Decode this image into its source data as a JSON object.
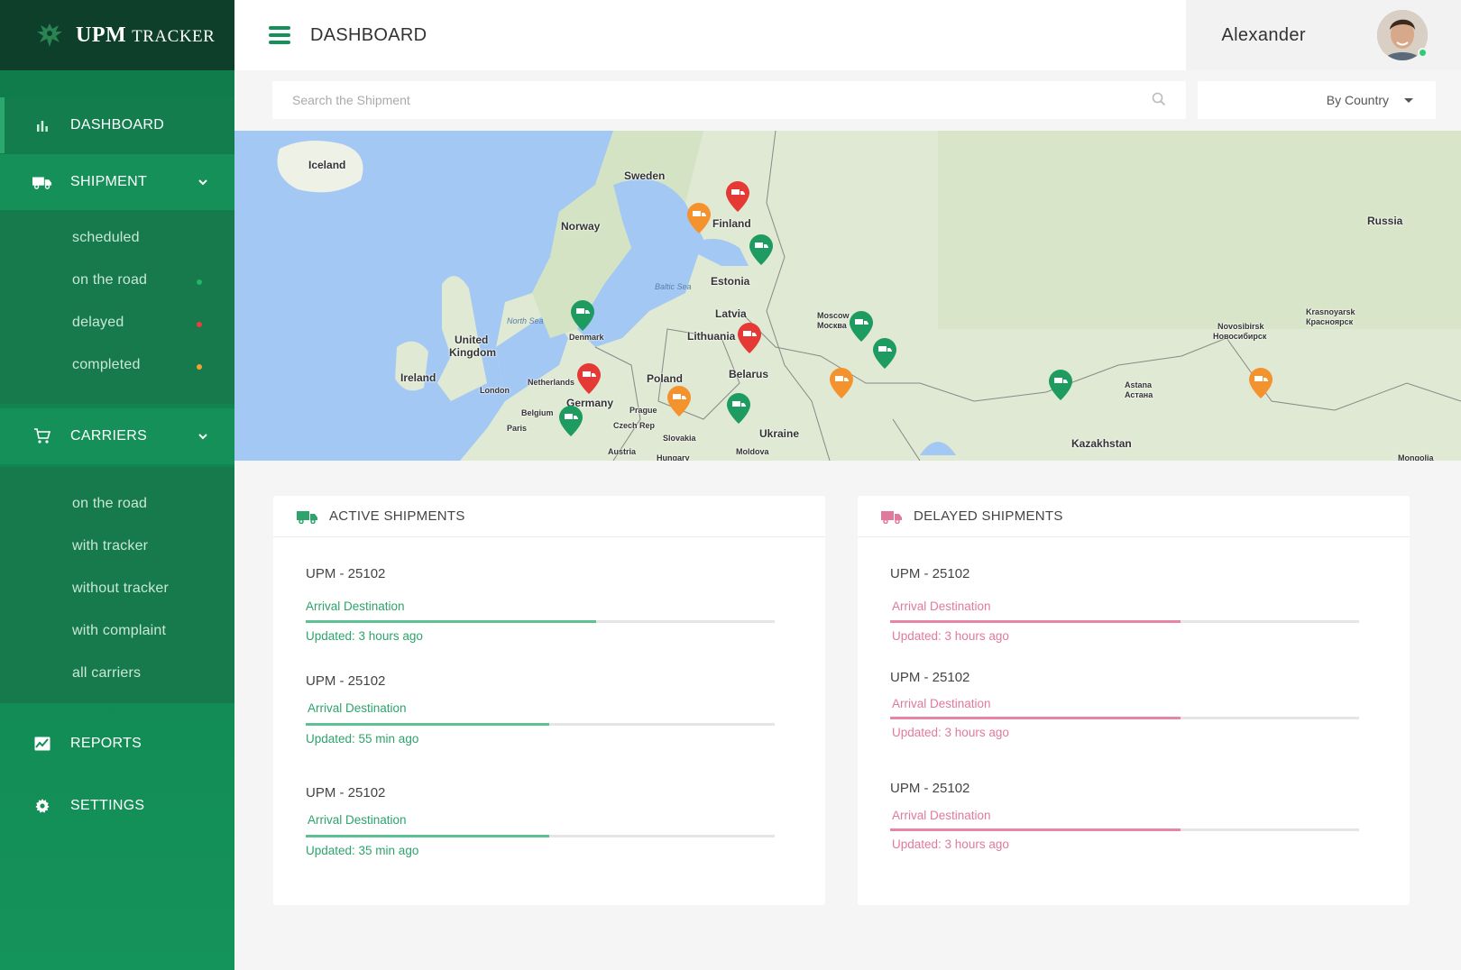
{
  "brand": {
    "strong": "UPM",
    "rest": "TRACKER"
  },
  "sidebar": {
    "dashboard": "DASHBOARD",
    "shipment": "SHIPMENT",
    "shipment_items": [
      {
        "label": "scheduled",
        "dot": ""
      },
      {
        "label": "on the road",
        "dot": "#1fb56a"
      },
      {
        "label": "delayed",
        "dot": "#ef3b3b"
      },
      {
        "label": "completed",
        "dot": "#f6a033"
      }
    ],
    "carriers": "CARRIERS",
    "carrier_items": [
      "on the road",
      "with tracker",
      "without tracker",
      "with complaint",
      "all carriers"
    ],
    "reports": "REPORTS",
    "settings": "SETTINGS"
  },
  "header": {
    "title": "DASHBOARD",
    "user": "Alexander"
  },
  "search": {
    "placeholder": "Search the Shipment",
    "value": ""
  },
  "filter": {
    "selected": "By Country"
  },
  "map": {
    "labels": {
      "iceland": "Iceland",
      "sweden": "Sweden",
      "finland": "Finland",
      "norway": "Norway",
      "estonia": "Estonia",
      "latvia": "Latvia",
      "lithuania": "Lithuania",
      "denmark": "Denmark",
      "united_kingdom_1": "United",
      "united_kingdom_2": "Kingdom",
      "ireland": "Ireland",
      "netherlands": "Netherlands",
      "belgium": "Belgium",
      "germany": "Germany",
      "poland": "Poland",
      "belarus": "Belarus",
      "ukraine": "Ukraine",
      "slovakia": "Slovakia",
      "czech": "Czech Rep",
      "prague": "Prague",
      "paris": "Paris",
      "london": "London",
      "austria": "Austria",
      "moldova": "Moldova",
      "hungary": "Hungary",
      "moscow": "Moscow",
      "moscow_ru": "Москва",
      "russia": "Russia",
      "kazakhstan": "Kazakhstan",
      "astana": "Astana",
      "astana_ru": "Астана",
      "novosibirsk": "Novosibirsk",
      "novosibirsk_ru": "Новосибирск",
      "krasnoyarsk": "Krasnoyarsk",
      "krasnoyarsk_ru": "Красноярск",
      "mongolia": "Mongolia",
      "north_sea": "North Sea",
      "baltic_sea": "Baltic Sea"
    },
    "pin_colors": {
      "red": "#e53935",
      "orange": "#f4922e",
      "green": "#1e9b60"
    }
  },
  "active": {
    "title": "ACTIVE SHIPMENTS",
    "items": [
      {
        "id": "UPM - 25102",
        "dest": "Arrival Destination",
        "progress": 0.62,
        "updated": "Updated: 3 hours ago"
      },
      {
        "id": "UPM - 25102",
        "dest": "Arrival Destination",
        "progress": 0.52,
        "updated": "Updated: 55 min ago"
      },
      {
        "id": "UPM - 25102",
        "dest": "Arrival Destination",
        "progress": 0.52,
        "updated": "Updated: 35 min ago"
      }
    ]
  },
  "delayed": {
    "title": "DELAYED SHIPMENTS",
    "items": [
      {
        "id": "UPM - 25102",
        "dest": "Arrival Destination",
        "progress": 0.62,
        "updated": "Updated: 3 hours ago"
      },
      {
        "id": "UPM - 25102",
        "dest": "Arrival Destination",
        "progress": 0.62,
        "updated": "Updated: 3 hours ago"
      },
      {
        "id": "UPM - 25102",
        "dest": "Arrival Destination",
        "progress": 0.62,
        "updated": "Updated: 3 hours ago"
      }
    ]
  }
}
